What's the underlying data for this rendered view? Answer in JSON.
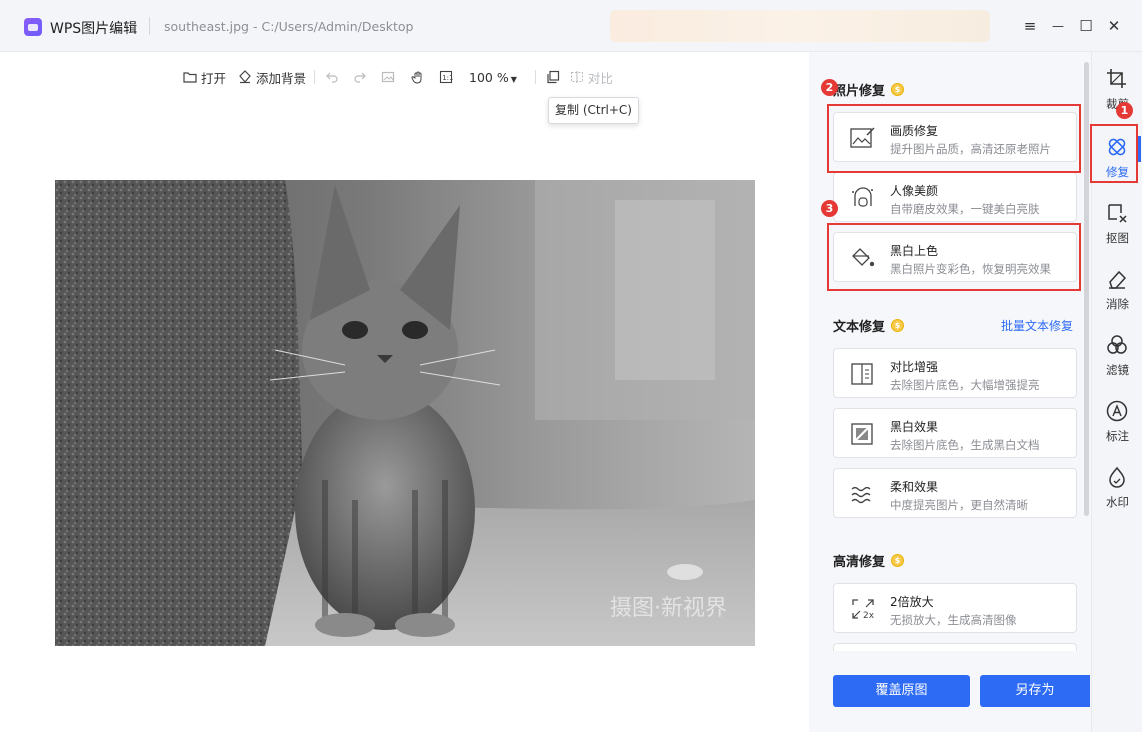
{
  "window": {
    "app_name": "WPS图片编辑",
    "file_name": "southeast.jpg",
    "file_path": "C:/Users/Admin/Desktop",
    "controls": {
      "menu": "≡",
      "minimize": "—",
      "maximize": "☐",
      "close": "✕"
    }
  },
  "toolbar": {
    "open": "打开",
    "add_background": "添加背景",
    "zoom": "100 %",
    "compare": "对比",
    "tooltip": "复制 (Ctrl+C)"
  },
  "photo": {
    "watermark": "摄图·新视界"
  },
  "panel": {
    "photo_repair": {
      "title": "照片修复",
      "cards": [
        {
          "title": "画质修复",
          "desc": "提升图片品质，高清还原老照片",
          "icon": "image-enhance-icon"
        },
        {
          "title": "人像美颜",
          "desc": "自带磨皮效果，一键美白亮肤",
          "icon": "portrait-icon"
        },
        {
          "title": "黑白上色",
          "desc": "黑白照片变彩色，恢复明亮效果",
          "icon": "paint-bucket-icon"
        }
      ]
    },
    "text_repair": {
      "title": "文本修复",
      "batch_link": "批量文本修复",
      "cards": [
        {
          "title": "对比增强",
          "desc": "去除图片底色，大幅增强提亮",
          "icon": "contrast-icon"
        },
        {
          "title": "黑白效果",
          "desc": "去除图片底色，生成黑白文档",
          "icon": "bw-doc-icon"
        },
        {
          "title": "柔和效果",
          "desc": "中度提亮图片，更自然清晰",
          "icon": "waves-icon"
        }
      ]
    },
    "hd_repair": {
      "title": "高清修复",
      "cards": [
        {
          "title": "2倍放大",
          "desc": "无损放大，生成高清图像",
          "icon": "upscale-icon"
        }
      ]
    },
    "buttons": {
      "overwrite": "覆盖原图",
      "save_as": "另存为"
    }
  },
  "nav": [
    {
      "label": "裁剪",
      "icon": "crop-icon"
    },
    {
      "label": "修复",
      "icon": "repair-icon",
      "active": true
    },
    {
      "label": "抠图",
      "icon": "cutout-icon"
    },
    {
      "label": "消除",
      "icon": "eraser-icon"
    },
    {
      "label": "滤镜",
      "icon": "filter-icon"
    },
    {
      "label": "标注",
      "icon": "annotate-icon"
    },
    {
      "label": "水印",
      "icon": "watermark-icon"
    }
  ],
  "annotations": {
    "badge1": "1",
    "badge2": "2",
    "badge3": "3"
  },
  "colors": {
    "accent": "#2d6bf5",
    "annotation": "#e53935",
    "coin": "#f7c948"
  }
}
